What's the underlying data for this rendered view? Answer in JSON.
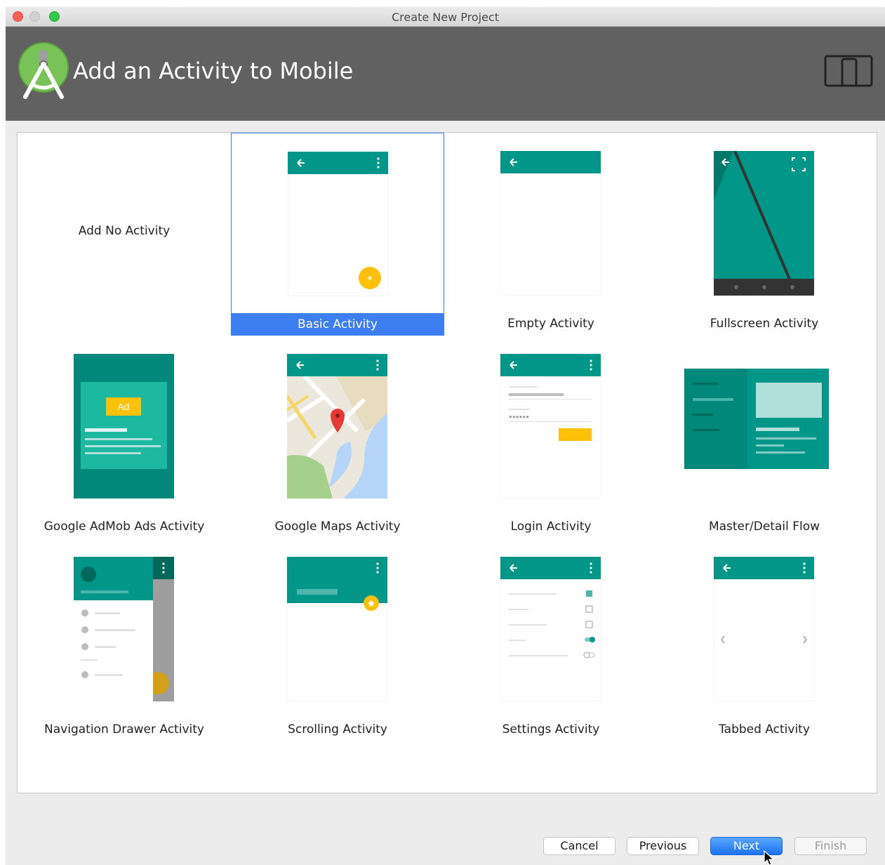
{
  "window": {
    "title": "Create New Project"
  },
  "header": {
    "title": "Add an Activity to Mobile"
  },
  "colors": {
    "teal": "#009688",
    "teal_dark": "#00796B",
    "accent_yellow": "#FFC107",
    "selection_blue": "#3D7FF2",
    "header_bg": "#616161"
  },
  "activities": [
    {
      "label": "Add No Activity",
      "icon": "no-activity"
    },
    {
      "label": "Basic Activity",
      "icon": "basic-activity-thumb",
      "selected": true
    },
    {
      "label": "Empty Activity",
      "icon": "empty-activity-thumb"
    },
    {
      "label": "Fullscreen Activity",
      "icon": "fullscreen-activity-thumb"
    },
    {
      "label": "Google AdMob Ads Activity",
      "icon": "admob-activity-thumb",
      "badge": "Ad"
    },
    {
      "label": "Google Maps Activity",
      "icon": "maps-activity-thumb"
    },
    {
      "label": "Login Activity",
      "icon": "login-activity-thumb"
    },
    {
      "label": "Master/Detail Flow",
      "icon": "master-detail-thumb"
    },
    {
      "label": "Navigation Drawer Activity",
      "icon": "nav-drawer-thumb"
    },
    {
      "label": "Scrolling Activity",
      "icon": "scrolling-activity-thumb"
    },
    {
      "label": "Settings Activity",
      "icon": "settings-activity-thumb"
    },
    {
      "label": "Tabbed Activity",
      "icon": "tabbed-activity-thumb"
    }
  ],
  "buttons": {
    "cancel": "Cancel",
    "previous": "Previous",
    "next": "Next",
    "finish": "Finish"
  }
}
